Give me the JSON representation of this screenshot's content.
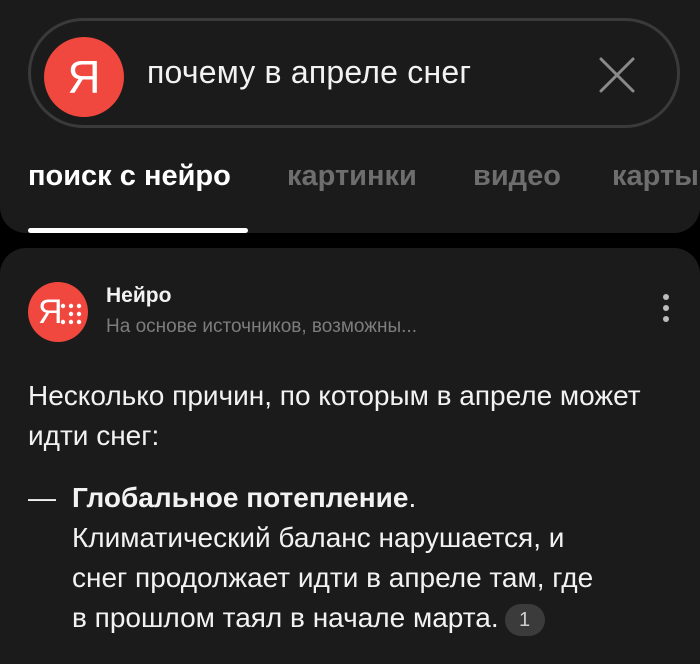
{
  "search": {
    "logo_letter": "Я",
    "query": "почему в апреле снег"
  },
  "tabs": [
    {
      "label": "поиск с нейро",
      "active": true
    },
    {
      "label": "картинки",
      "active": false
    },
    {
      "label": "видео",
      "active": false
    },
    {
      "label": "карты",
      "active": false
    }
  ],
  "answer": {
    "source_name": "Нейро",
    "source_subtitle": "На основе источников, возможны...",
    "intro": "Несколько причин, по которым в апреле может идти снег:",
    "items": [
      {
        "dash": "—",
        "title": "Глобальное потепление",
        "title_punct": ".",
        "lines": [
          "Климатический баланс нарушается, и",
          "снег продолжает идти в апреле там, где",
          "в прошлом таял в начале марта."
        ],
        "ref": "1"
      }
    ]
  },
  "icons": {
    "search_logo": "yandex-logo-icon",
    "clear": "close-icon",
    "neuro": "neuro-logo-icon",
    "menu": "more-vertical-icon"
  },
  "colors": {
    "accent": "#f0483e",
    "background": "#000000",
    "card": "#1b1b1b",
    "text": "#f2f2f2",
    "muted": "#7d7d7d"
  }
}
